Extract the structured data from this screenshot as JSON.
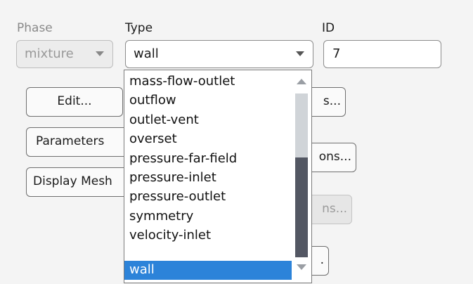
{
  "labels": {
    "phase": "Phase",
    "type": "Type",
    "id": "ID"
  },
  "phase_select": {
    "value": "mixture",
    "icon": "chevron-down-icon"
  },
  "type_select": {
    "value": "wall",
    "icon": "chevron-down-icon"
  },
  "id_field": {
    "value": "7"
  },
  "buttons": {
    "edit": "Edit...",
    "parameters": "Parameters",
    "display_mesh": "Display Mesh",
    "right_1": "s...",
    "right_2": "ons...",
    "right_3": "ns...",
    "right_4": "."
  },
  "dropdown": {
    "options": [
      "mass-flow-outlet",
      "outflow",
      "outlet-vent",
      "overset",
      "pressure-far-field",
      "pressure-inlet",
      "pressure-outlet",
      "symmetry",
      "velocity-inlet",
      "wall"
    ],
    "selected": "wall"
  },
  "colors": {
    "selection": "#2c83d9",
    "scroll_thumb": "#535763"
  }
}
